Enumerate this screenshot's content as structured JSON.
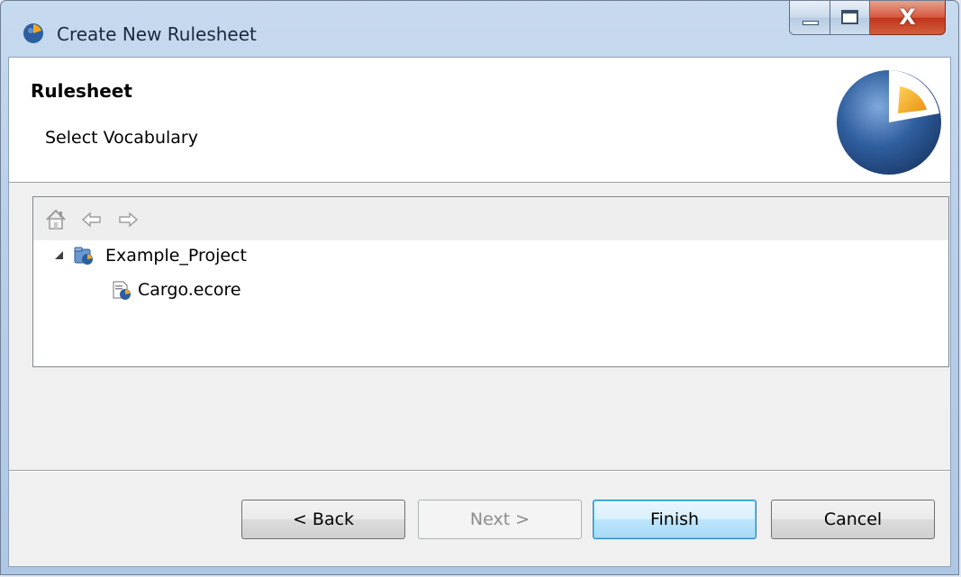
{
  "window": {
    "title": "Create New Rulesheet",
    "controls": {
      "close_glyph": "X"
    }
  },
  "header": {
    "title": "Rulesheet",
    "subtitle": "Select Vocabulary"
  },
  "toolbar": {
    "icons": [
      "home-icon",
      "back-arrow-icon",
      "forward-arrow-icon"
    ]
  },
  "tree": {
    "project": {
      "label": "Example_Project",
      "expanded": true,
      "icon": "project-icon"
    },
    "file": {
      "label": "Cargo.ecore",
      "selected": true,
      "icon": "vocabulary-file-icon"
    }
  },
  "buttons": {
    "back": "< Back",
    "next": "Next >",
    "finish": "Finish",
    "cancel": "Cancel"
  },
  "colors": {
    "logo_blue": "#2d5fa0",
    "logo_orange": "#f5a81c",
    "default_button_border": "#3c7fb1",
    "close_red": "#c7381c"
  }
}
